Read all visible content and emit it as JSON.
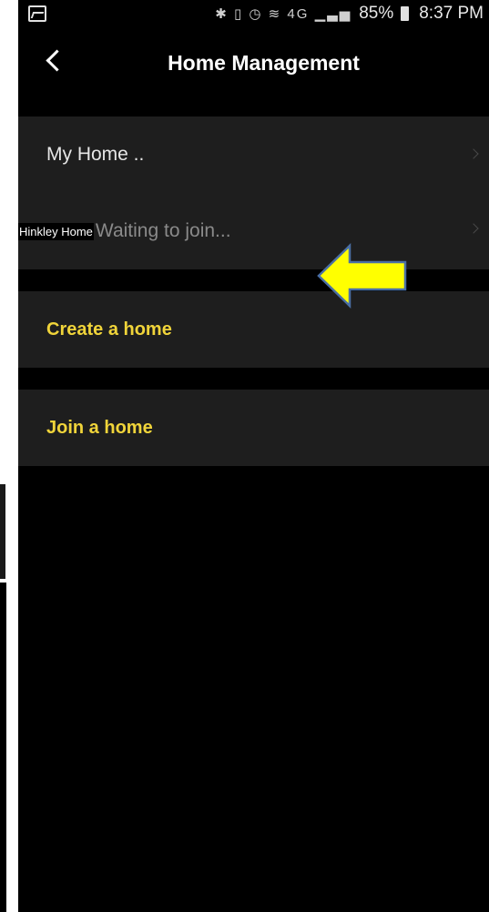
{
  "status_bar": {
    "battery": "85%",
    "time": "8:37 PM",
    "network": "4G",
    "icons": [
      "gallery-icon",
      "bluetooth-icon",
      "vibrate-icon",
      "alarm-icon",
      "wifi-icon",
      "signal-icon",
      "battery-icon"
    ]
  },
  "header": {
    "title": "Home Management",
    "back_icon": "chevron-left-icon"
  },
  "homes": [
    {
      "label": "My Home .."
    },
    {
      "name_label": "Hinkley Home",
      "status": "Waiting to join..."
    }
  ],
  "actions": {
    "create": "Create a home",
    "join": "Join a home"
  },
  "colors": {
    "accent": "#f0d43a",
    "row_background": "#1e1e1e",
    "screen_background": "#000000",
    "arrow_fill": "#ffff00",
    "arrow_stroke": "#4a6fa5"
  }
}
